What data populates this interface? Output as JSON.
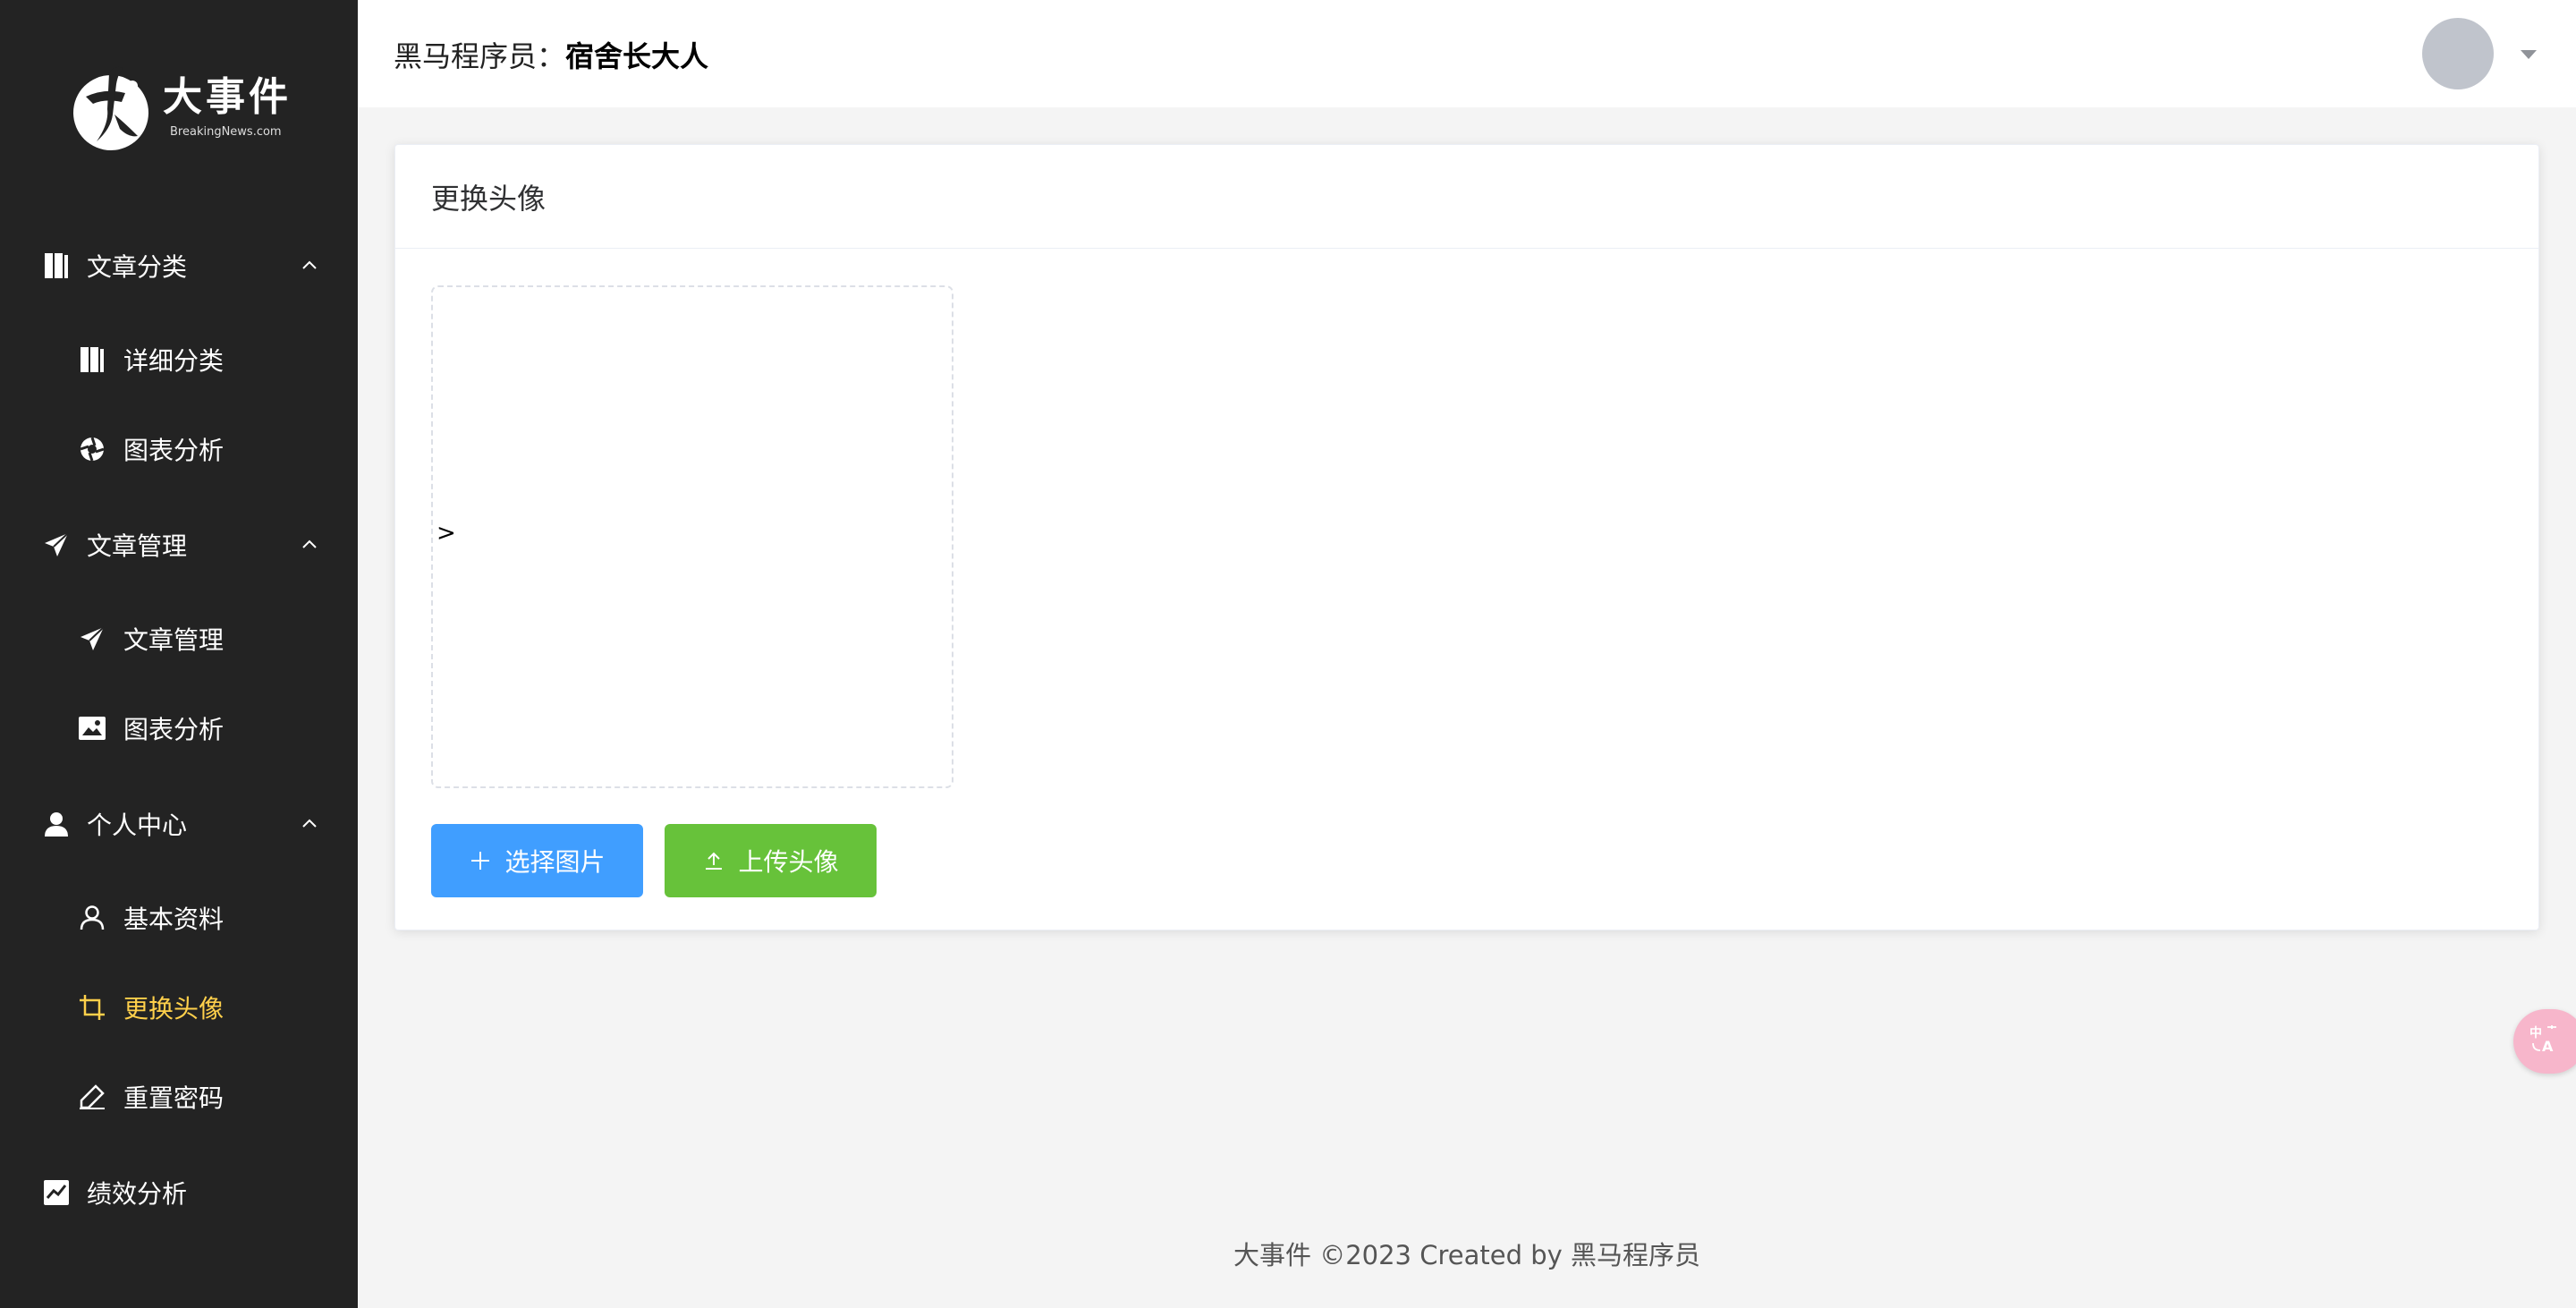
{
  "logo": {
    "title": "大事件",
    "subtitle": "BreakingNews.com"
  },
  "sidebar": {
    "items": [
      {
        "label": "文章分类",
        "icon": "book-icon",
        "level": 1,
        "expanded": true
      },
      {
        "label": "详细分类",
        "icon": "book-icon",
        "level": 2
      },
      {
        "label": "图表分析",
        "icon": "aperture-icon",
        "level": 2
      },
      {
        "label": "文章管理",
        "icon": "paper-plane-icon",
        "level": 1,
        "expanded": true
      },
      {
        "label": "文章管理",
        "icon": "paper-plane-icon",
        "level": 2
      },
      {
        "label": "图表分析",
        "icon": "picture-icon",
        "level": 2
      },
      {
        "label": "个人中心",
        "icon": "user-solid-icon",
        "level": 1,
        "expanded": true
      },
      {
        "label": "基本资料",
        "icon": "user-outline-icon",
        "level": 2
      },
      {
        "label": "更换头像",
        "icon": "crop-icon",
        "level": 2,
        "active": true
      },
      {
        "label": "重置密码",
        "icon": "edit-pen-icon",
        "level": 2
      },
      {
        "label": "绩效分析",
        "icon": "trend-chart-icon",
        "level": 1
      }
    ],
    "active_color": "#ffd04b",
    "background": "#232323"
  },
  "header": {
    "prefix": "黑马程序员：",
    "username": "宿舍长大人"
  },
  "card": {
    "title": "更换头像",
    "preview_text": ">",
    "select_button": "选择图片",
    "upload_button": "上传头像"
  },
  "footer": {
    "text": "大事件 ©2023 Created by 黑马程序员"
  },
  "colors": {
    "primary": "#409eff",
    "success": "#67c23a"
  }
}
